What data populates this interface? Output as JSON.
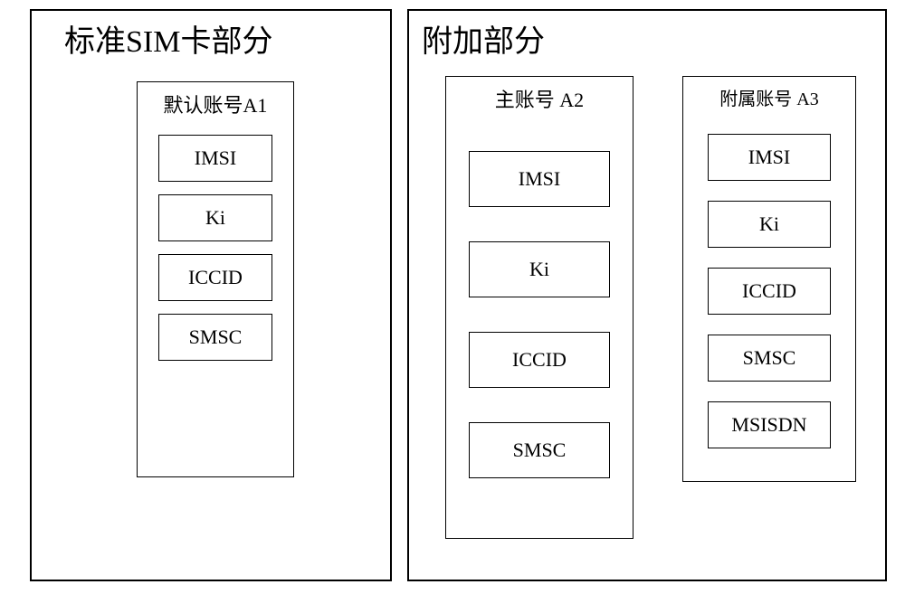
{
  "left_panel": {
    "title": "标准SIM卡部分",
    "account": {
      "title": "默认账号A1",
      "fields": [
        "IMSI",
        "Ki",
        "ICCID",
        "SMSC"
      ]
    }
  },
  "right_panel": {
    "title": "附加部分",
    "account_main": {
      "title": "主账号 A2",
      "fields": [
        "IMSI",
        "Ki",
        "ICCID",
        "SMSC"
      ]
    },
    "account_sub": {
      "title": "附属账号 A3",
      "fields": [
        "IMSI",
        "Ki",
        "ICCID",
        "SMSC",
        "MSISDN"
      ]
    }
  }
}
